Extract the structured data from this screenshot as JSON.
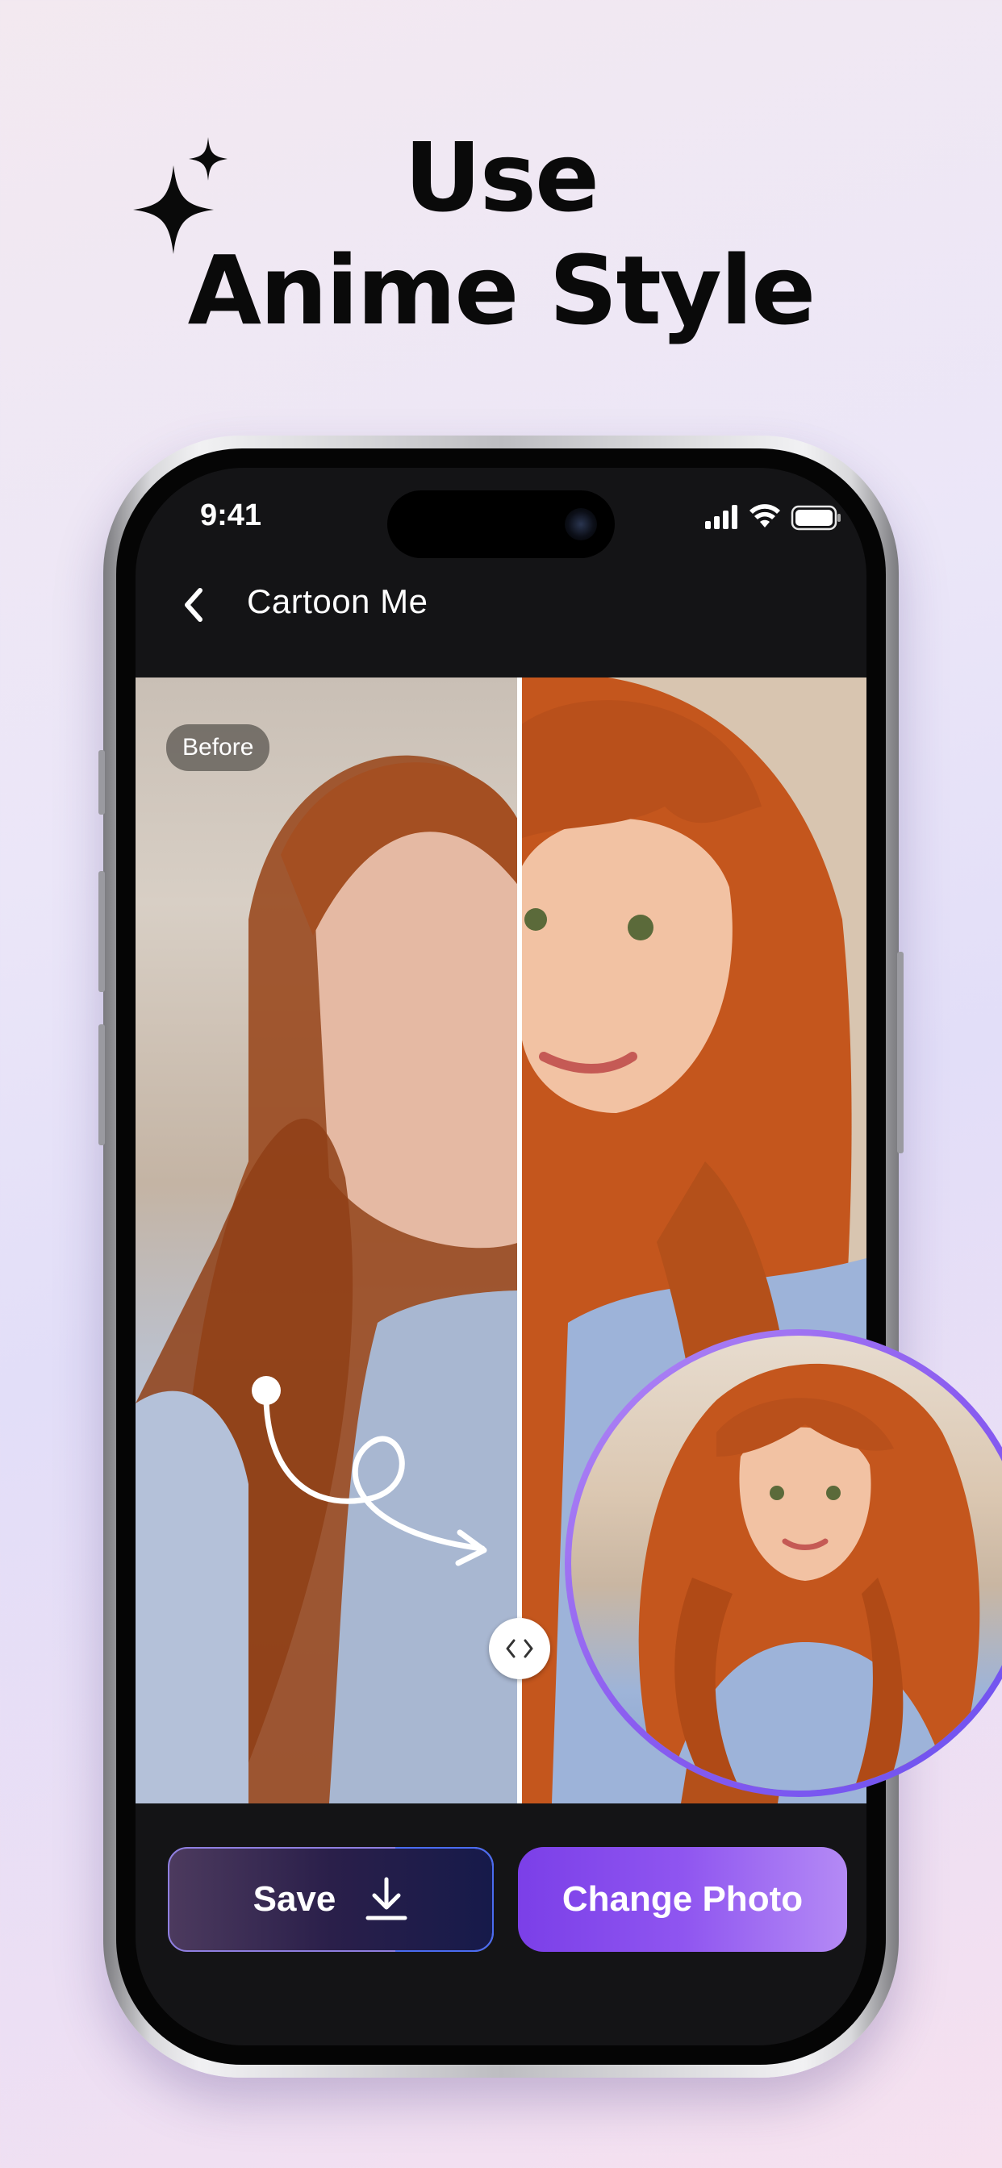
{
  "headline": {
    "line1": "Use",
    "line2": "Anime Style"
  },
  "status_bar": {
    "time": "9:41"
  },
  "nav": {
    "title": "Cartoon Me"
  },
  "compare": {
    "before_label": "Before"
  },
  "actions": {
    "save_label": "Save",
    "change_label": "Change Photo"
  },
  "colors": {
    "accent_purple": "#8f55f0",
    "screen_bg": "#141416"
  }
}
